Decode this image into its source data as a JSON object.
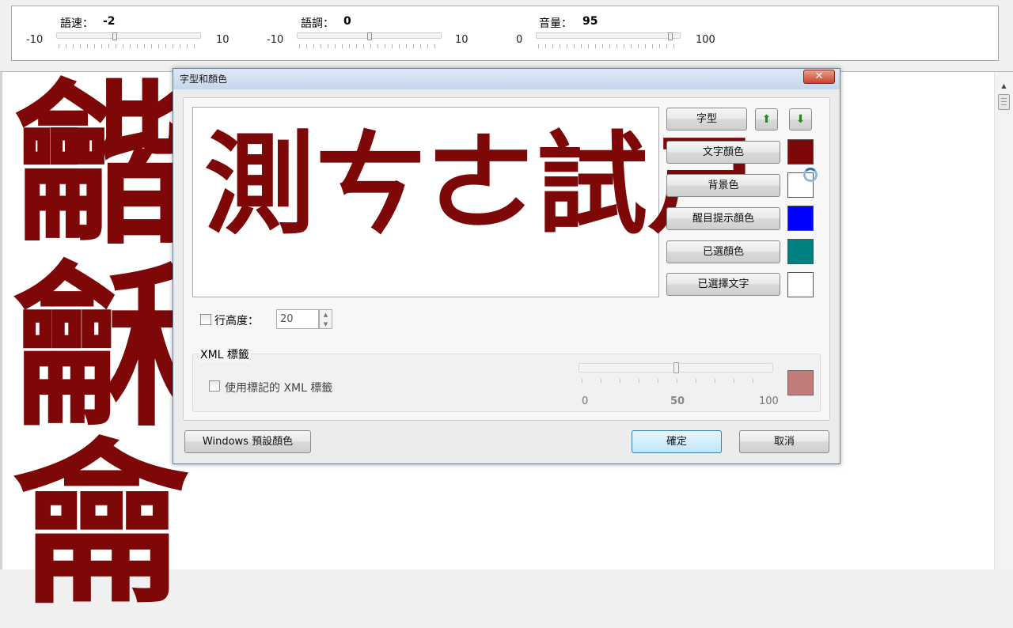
{
  "top_panel": {
    "sliders": [
      {
        "label": "語速：",
        "value": "-2",
        "min": "-10",
        "max": "10",
        "level": 0.4
      },
      {
        "label": "語調：",
        "value": "0",
        "min": "-10",
        "max": "10",
        "level": 0.5
      },
      {
        "label": "音量：",
        "value": "95",
        "min": "0",
        "max": "100",
        "level": 0.95
      }
    ]
  },
  "background_doc": {
    "glyphs": [
      "龤",
      "龢",
      "龠"
    ]
  },
  "dialog": {
    "title": "字型和顏色",
    "close_glyph": "✕",
    "preview_text": "測ㄘㄜ試ㄕ",
    "buttons": {
      "font": "字型",
      "up_glyph": "⬆",
      "down_glyph": "⬇",
      "text_color": "文字顏色",
      "background_color": "背景色",
      "highlight_color": "醒目提示顏色",
      "selected_color": "已選顏色",
      "selected_text": "已選擇文字",
      "windows_default": "Windows 預設顏色",
      "ok": "確定",
      "cancel": "取消"
    },
    "swatches": {
      "text_color": "#7e0707",
      "background_color": "#ffffff",
      "highlight_color": "#0000ff",
      "selected_color": "#008080",
      "selected_text": "#ffffff"
    },
    "line_height": {
      "label": "行高度：",
      "value": "20",
      "checked": false
    },
    "xml": {
      "group_label": "XML 標籤",
      "checkbox_label": "使用標記的 XML 標籤",
      "checked": false,
      "opacity_level": 0.5,
      "scale": {
        "min": "0",
        "mid": "50",
        "max": "100"
      },
      "swatch": "#c07b7b"
    }
  }
}
